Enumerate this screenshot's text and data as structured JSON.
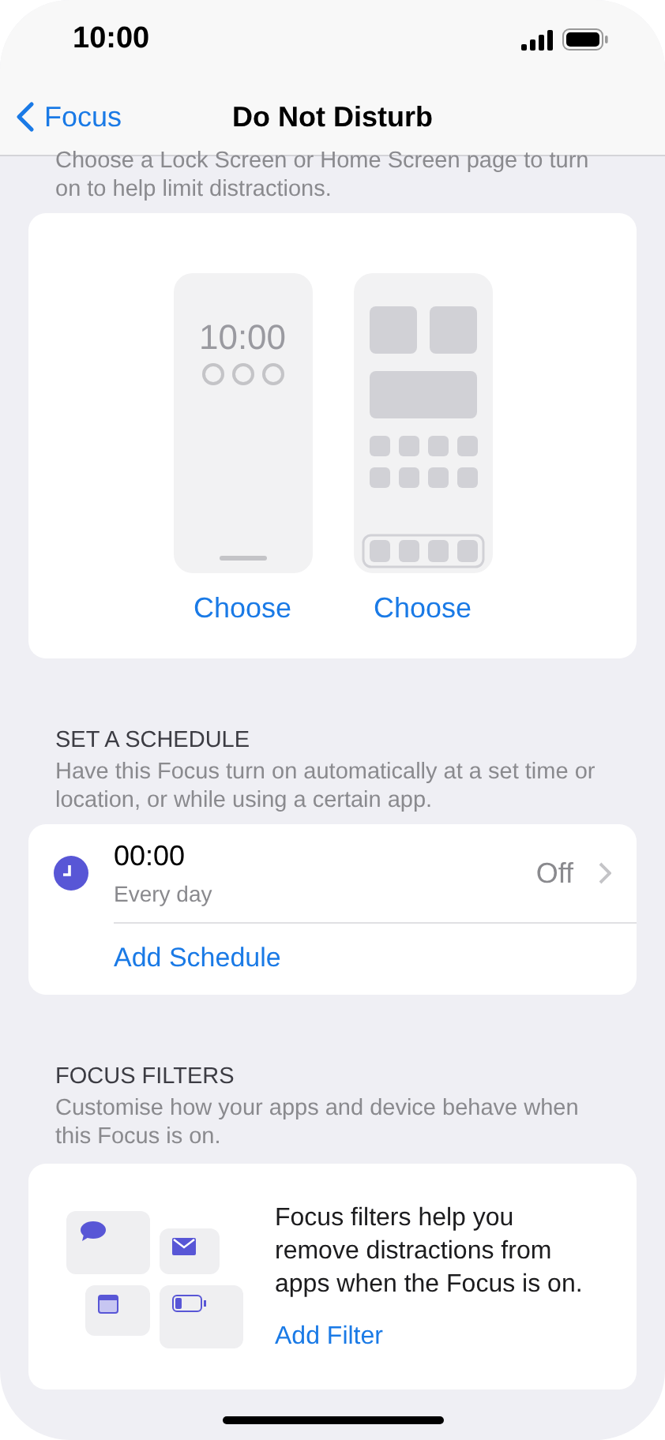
{
  "status_bar": {
    "time": "10:00"
  },
  "nav": {
    "back": "Focus",
    "title": "Do Not Disturb"
  },
  "intro": "Choose a Lock Screen or Home Screen page to turn on to help limit distractions.",
  "pages": [
    {
      "kind": "lock",
      "clock": "10:00",
      "action": "Choose"
    },
    {
      "kind": "home",
      "action": "Choose"
    }
  ],
  "schedule": {
    "header": "SET A SCHEDULE",
    "description": "Have this Focus turn on automatically at a set time or location, or while using a certain app.",
    "items": [
      {
        "time": "00:00",
        "repeat": "Every day",
        "state": "Off"
      }
    ],
    "add": "Add Schedule"
  },
  "filters": {
    "header": "FOCUS FILTERS",
    "description": "Customise how your apps and device behave when this Focus is on.",
    "text": "Focus filters help you remove distractions from apps when the Focus is on.",
    "add": "Add Filter"
  }
}
